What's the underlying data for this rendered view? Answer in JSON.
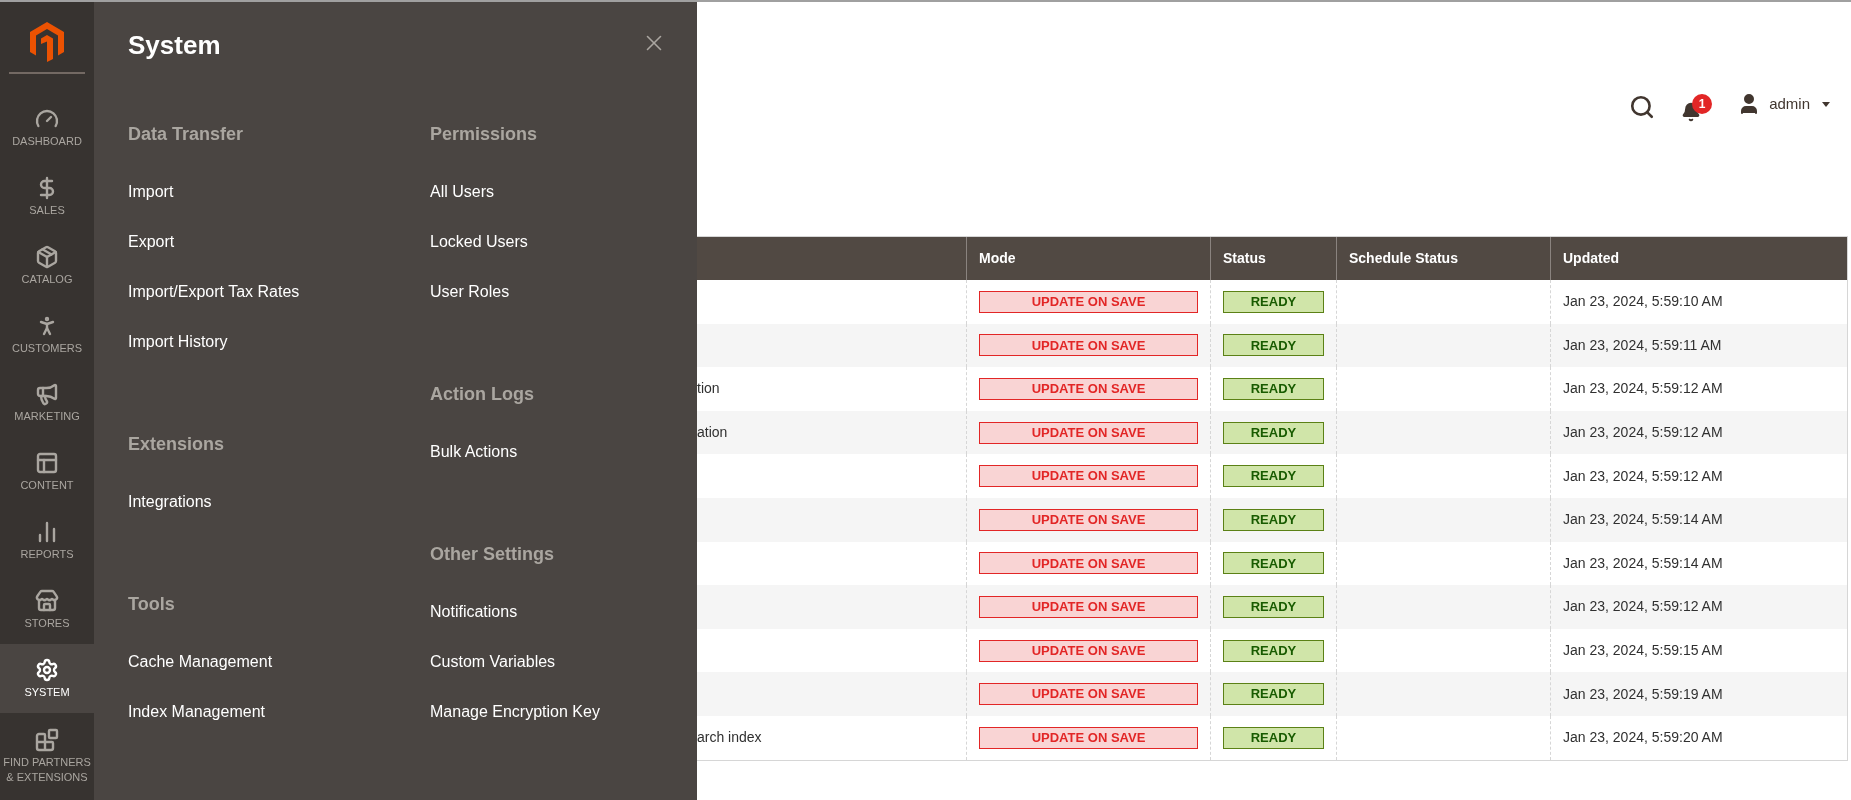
{
  "sidebar": {
    "items": [
      {
        "label": "DASHBOARD",
        "selected": false
      },
      {
        "label": "SALES",
        "selected": false
      },
      {
        "label": "CATALOG",
        "selected": false
      },
      {
        "label": "CUSTOMERS",
        "selected": false
      },
      {
        "label": "MARKETING",
        "selected": false
      },
      {
        "label": "CONTENT",
        "selected": false
      },
      {
        "label": "REPORTS",
        "selected": false
      },
      {
        "label": "STORES",
        "selected": false
      },
      {
        "label": "SYSTEM",
        "selected": true
      },
      {
        "label": "FIND PARTNERS & EXTENSIONS",
        "selected": false
      }
    ]
  },
  "menu": {
    "title": "System",
    "columns": [
      [
        {
          "heading": "Data Transfer",
          "items": [
            "Import",
            "Export",
            "Import/Export Tax Rates",
            "Import History"
          ]
        },
        {
          "heading": "Extensions",
          "items": [
            "Integrations"
          ]
        },
        {
          "heading": "Tools",
          "items": [
            "Cache Management",
            "Index Management"
          ]
        }
      ],
      [
        {
          "heading": "Permissions",
          "items": [
            "All Users",
            "Locked Users",
            "User Roles"
          ]
        },
        {
          "heading": "Action Logs",
          "items": [
            "Bulk Actions"
          ]
        },
        {
          "heading": "Other Settings",
          "items": [
            "Notifications",
            "Custom Variables",
            "Manage Encryption Key"
          ]
        }
      ]
    ]
  },
  "header": {
    "notification_count": "1",
    "user": "admin"
  },
  "table": {
    "columns": [
      "Mode",
      "Status",
      "Schedule Status",
      "Updated"
    ],
    "rows": [
      {
        "mode": "UPDATE ON SAVE",
        "status": "READY",
        "updated": "Jan 23, 2024, 5:59:10 AM"
      },
      {
        "mode": "UPDATE ON SAVE",
        "status": "READY",
        "updated": "Jan 23, 2024, 5:59:11 AM"
      },
      {
        "column_1": "tion",
        "mode": "UPDATE ON SAVE",
        "status": "READY",
        "updated": "Jan 23, 2024, 5:59:12 AM"
      },
      {
        "column_1": "ation",
        "mode": "UPDATE ON SAVE",
        "status": "READY",
        "updated": "Jan 23, 2024, 5:59:12 AM"
      },
      {
        "mode": "UPDATE ON SAVE",
        "status": "READY",
        "updated": "Jan 23, 2024, 5:59:12 AM"
      },
      {
        "mode": "UPDATE ON SAVE",
        "status": "READY",
        "updated": "Jan 23, 2024, 5:59:14 AM"
      },
      {
        "mode": "UPDATE ON SAVE",
        "status": "READY",
        "updated": "Jan 23, 2024, 5:59:14 AM"
      },
      {
        "mode": "UPDATE ON SAVE",
        "status": "READY",
        "updated": "Jan 23, 2024, 5:59:12 AM"
      },
      {
        "mode": "UPDATE ON SAVE",
        "status": "READY",
        "updated": "Jan 23, 2024, 5:59:15 AM"
      },
      {
        "mode": "UPDATE ON SAVE",
        "status": "READY",
        "updated": "Jan 23, 2024, 5:59:19 AM"
      },
      {
        "column_1": "arch index",
        "mode": "UPDATE ON SAVE",
        "status": "READY",
        "updated": "Jan 23, 2024, 5:59:20 AM"
      }
    ]
  }
}
